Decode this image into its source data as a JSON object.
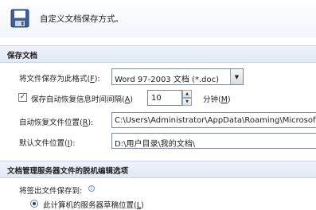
{
  "header": {
    "title": "自定义文档保存方式。",
    "icon": "save-icon"
  },
  "sections": {
    "save_docs": "保存文档",
    "offline_edit": "文档管理服务器文件的脱机编辑选项"
  },
  "format": {
    "label": "将文件保存为此格式(",
    "key": "F",
    "suffix": "):",
    "selected": "Word 97-2003 文档 (*.doc)"
  },
  "autorecover": {
    "label": "保存自动恢复信息时间间隔(",
    "key": "A",
    "suffix": ")",
    "checked": true,
    "value": "10",
    "unit_label": "分钟(",
    "unit_key": "M",
    "unit_suffix": ")"
  },
  "autorecover_location": {
    "label": "自动恢复文件位置(",
    "key": "R",
    "suffix": "):",
    "value": "C:\\Users\\Administrator\\AppData\\Roaming\\Microsoft\\Word\\"
  },
  "default_location": {
    "label": "默认文件位置(",
    "key": "I",
    "suffix": "):",
    "value": "D:\\用户目录\\我的文档\\"
  },
  "checkout": {
    "label": "将签出文件保存到:",
    "option": "此计算机的服务器草稿位置(",
    "option_key": "L",
    "option_suffix": ")"
  },
  "colors": {
    "section_bg": "#e1e9f4",
    "accent": "#1e3f75"
  }
}
